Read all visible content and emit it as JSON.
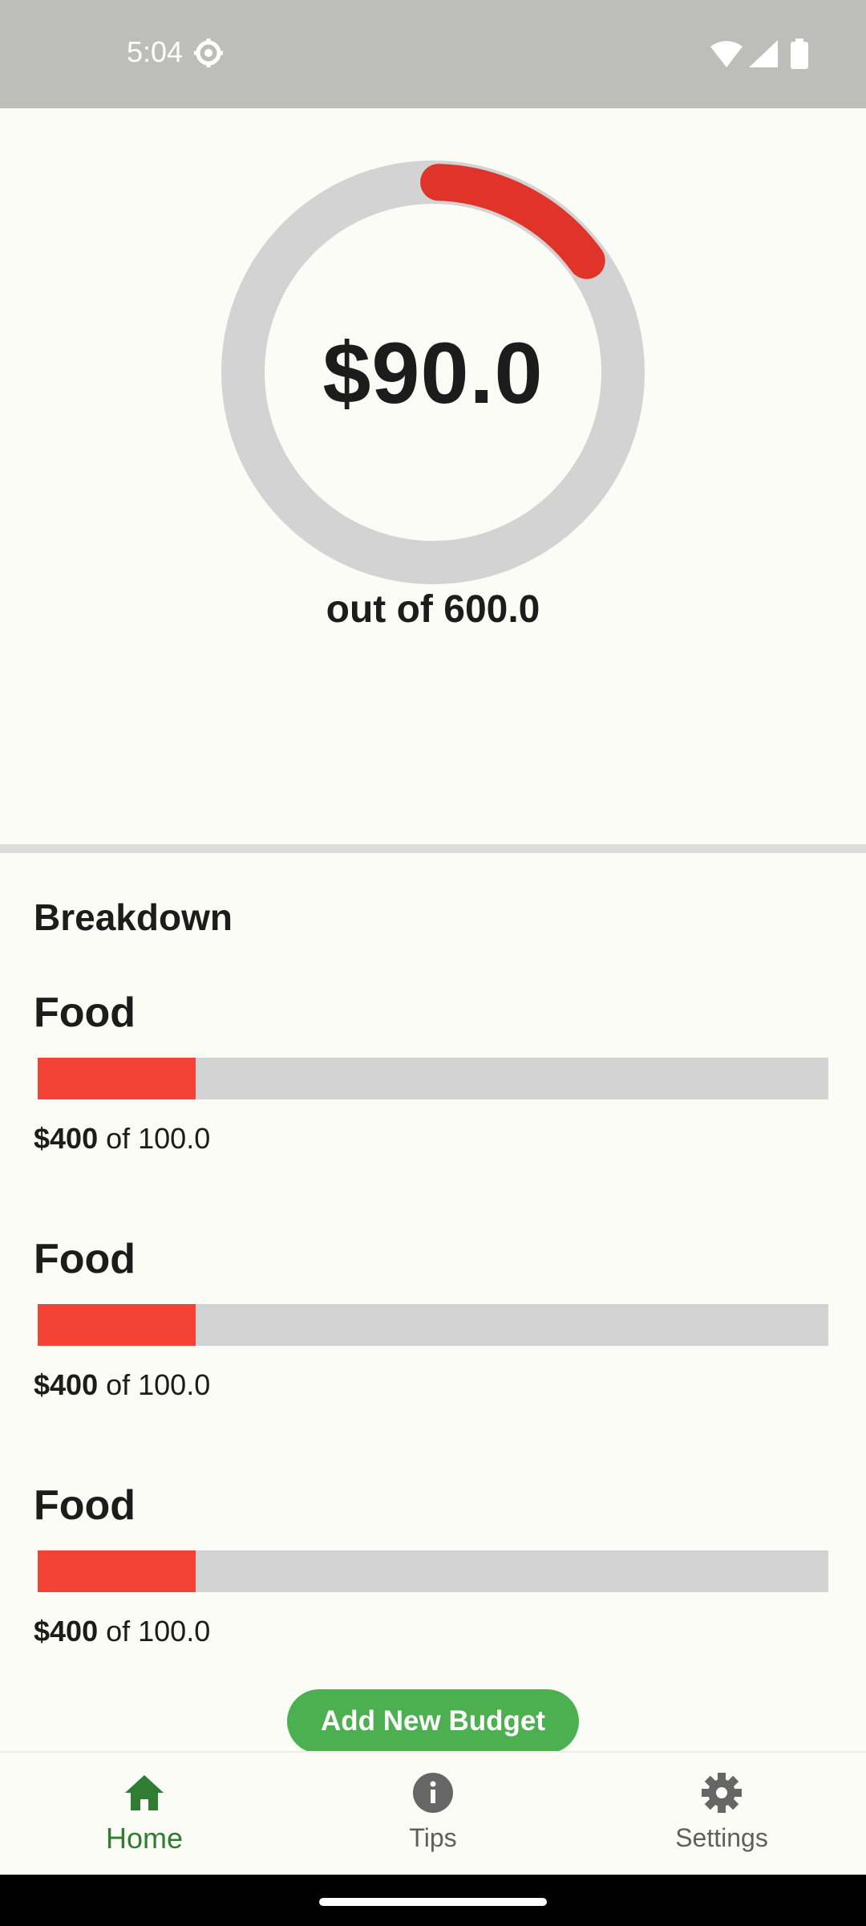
{
  "status_bar": {
    "time": "5:04",
    "icons": [
      "settings-gear-icon",
      "wifi-icon",
      "signal-icon",
      "battery-icon"
    ]
  },
  "summary": {
    "amount": "$90.0",
    "subtitle": "out of 600.0",
    "spent_fraction": 0.15,
    "colors": {
      "progress": "#E0342B",
      "track": "#D3D3D3"
    }
  },
  "breakdown": {
    "title": "Breakdown",
    "items": [
      {
        "name": "Food",
        "amount": "$400",
        "of_text": "of 100.0",
        "fill_fraction": 0.2
      },
      {
        "name": "Food",
        "amount": "$400",
        "of_text": "of 100.0",
        "fill_fraction": 0.2
      },
      {
        "name": "Food",
        "amount": "$400",
        "of_text": "of 100.0",
        "fill_fraction": 0.2
      }
    ],
    "colors": {
      "fill": "#F44336",
      "track": "#D2D2D2"
    }
  },
  "actions": {
    "add_budget_label": "Add New Budget"
  },
  "nav": {
    "items": [
      {
        "label": "Home",
        "icon": "home-icon",
        "active": true
      },
      {
        "label": "Tips",
        "icon": "info-icon",
        "active": false
      },
      {
        "label": "Settings",
        "icon": "gear-icon",
        "active": false
      }
    ],
    "colors": {
      "active": "#2E7D32",
      "inactive": "#5F5F5F"
    }
  }
}
